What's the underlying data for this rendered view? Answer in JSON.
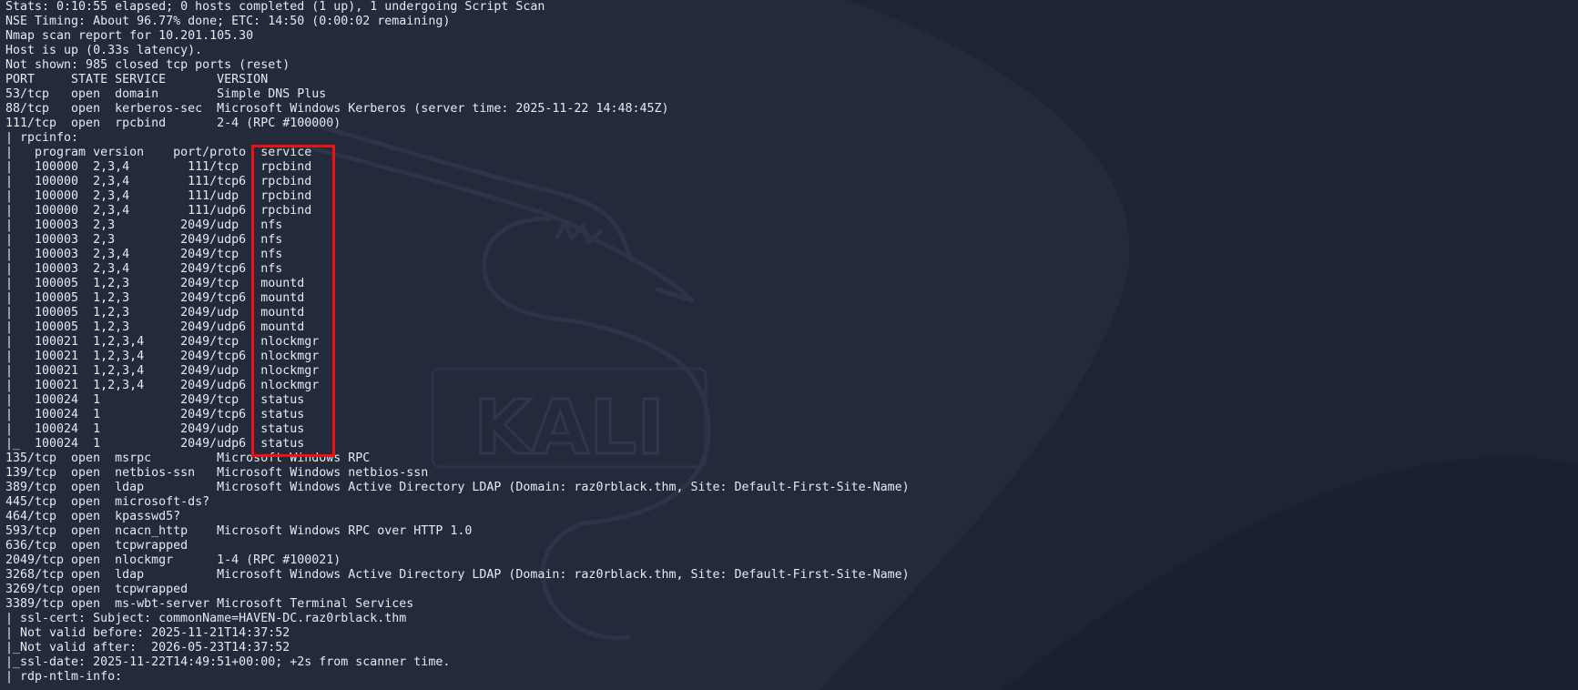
{
  "terminal": {
    "background_color": "#232a3b",
    "text_color": "#e7e9ee",
    "lines": [
      "Stats: 0:10:55 elapsed; 0 hosts completed (1 up), 1 undergoing Script Scan",
      "NSE Timing: About 96.77% done; ETC: 14:50 (0:00:02 remaining)",
      "Nmap scan report for 10.201.105.30",
      "Host is up (0.33s latency).",
      "Not shown: 985 closed tcp ports (reset)",
      "PORT     STATE SERVICE       VERSION",
      "53/tcp   open  domain        Simple DNS Plus",
      "88/tcp   open  kerberos-sec  Microsoft Windows Kerberos (server time: 2025-11-22 14:48:45Z)",
      "111/tcp  open  rpcbind       2-4 (RPC #100000)",
      "| rpcinfo:",
      "|   program version    port/proto  service",
      "|   100000  2,3,4        111/tcp   rpcbind",
      "|   100000  2,3,4        111/tcp6  rpcbind",
      "|   100000  2,3,4        111/udp   rpcbind",
      "|   100000  2,3,4        111/udp6  rpcbind",
      "|   100003  2,3         2049/udp   nfs",
      "|   100003  2,3         2049/udp6  nfs",
      "|   100003  2,3,4       2049/tcp   nfs",
      "|   100003  2,3,4       2049/tcp6  nfs",
      "|   100005  1,2,3       2049/tcp   mountd",
      "|   100005  1,2,3       2049/tcp6  mountd",
      "|   100005  1,2,3       2049/udp   mountd",
      "|   100005  1,2,3       2049/udp6  mountd",
      "|   100021  1,2,3,4     2049/tcp   nlockmgr",
      "|   100021  1,2,3,4     2049/tcp6  nlockmgr",
      "|   100021  1,2,3,4     2049/udp   nlockmgr",
      "|   100021  1,2,3,4     2049/udp6  nlockmgr",
      "|   100024  1           2049/tcp   status",
      "|   100024  1           2049/tcp6  status",
      "|   100024  1           2049/udp   status",
      "|_  100024  1           2049/udp6  status",
      "135/tcp  open  msrpc         Microsoft Windows RPC",
      "139/tcp  open  netbios-ssn   Microsoft Windows netbios-ssn",
      "389/tcp  open  ldap          Microsoft Windows Active Directory LDAP (Domain: raz0rblack.thm, Site: Default-First-Site-Name)",
      "445/tcp  open  microsoft-ds?",
      "464/tcp  open  kpasswd5?",
      "593/tcp  open  ncacn_http    Microsoft Windows RPC over HTTP 1.0",
      "636/tcp  open  tcpwrapped",
      "2049/tcp open  nlockmgr      1-4 (RPC #100021)",
      "3268/tcp open  ldap          Microsoft Windows Active Directory LDAP (Domain: raz0rblack.thm, Site: Default-First-Site-Name)",
      "3269/tcp open  tcpwrapped",
      "3389/tcp open  ms-wbt-server Microsoft Terminal Services",
      "| ssl-cert: Subject: commonName=HAVEN-DC.raz0rblack.thm",
      "| Not valid before: 2025-11-21T14:37:52",
      "|_Not valid after:  2026-05-23T14:37:52",
      "|_ssl-date: 2025-11-22T14:49:51+00:00; +2s from scanner time.",
      "| rdp-ntlm-info:"
    ]
  },
  "watermark": {
    "text": "KALI",
    "icon": "kali-dragon-icon",
    "color": "#2c3447"
  },
  "annotation": {
    "box_color": "#ef1111",
    "target": "rpcinfo service column"
  }
}
